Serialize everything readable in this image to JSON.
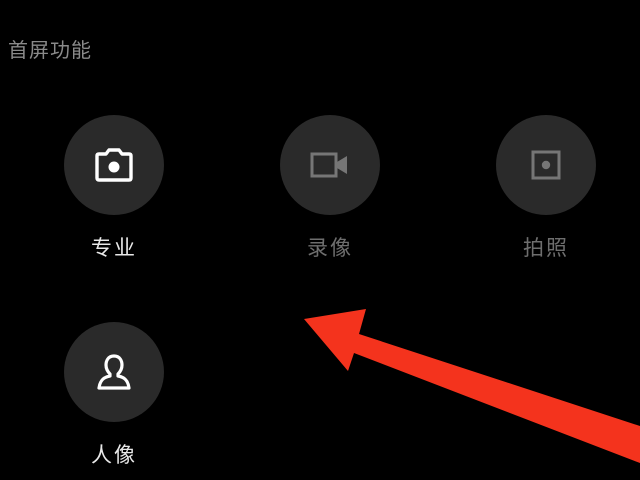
{
  "section": {
    "title": "首屏功能"
  },
  "modes": [
    {
      "label": "专业",
      "icon": "camera-icon",
      "enabled": true
    },
    {
      "label": "录像",
      "icon": "video-icon",
      "enabled": false
    },
    {
      "label": "拍照",
      "icon": "photo-frame-icon",
      "enabled": false
    },
    {
      "label": "人像",
      "icon": "person-icon",
      "enabled": true
    }
  ],
  "colors": {
    "background": "#000000",
    "circle": "#2a2a2a",
    "label_active": "#e8e8e8",
    "label_dim": "#6e6e6e",
    "icon_active": "#ffffff",
    "icon_dim": "#767676",
    "annotation_arrow": "#f4331d"
  }
}
